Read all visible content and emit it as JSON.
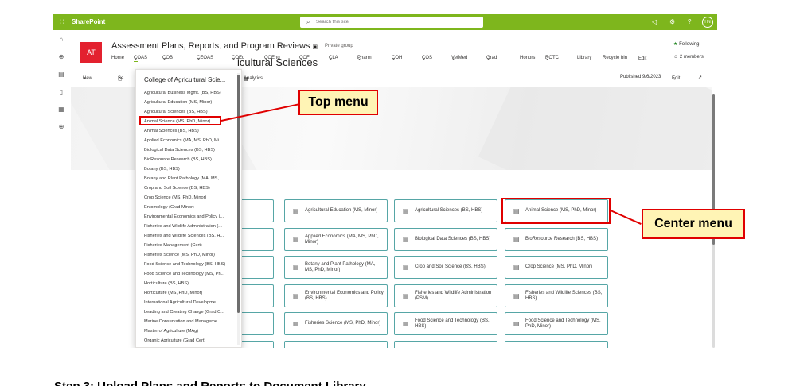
{
  "suitebar": {
    "app_name": "SharePoint",
    "search_placeholder": "Search this site",
    "avatar_initials": "HN"
  },
  "site": {
    "logo_text": "AT",
    "title": "Assessment Plans, Reports, and Program Reviews",
    "group_type": "Private group",
    "following": "Following",
    "members": "2 members",
    "nav": [
      "Home",
      "COAS",
      "COB",
      "CEOAS",
      "COEd",
      "COEng",
      "COF",
      "CLA",
      "Pharm",
      "COH",
      "COS",
      "VetMed",
      "Grad",
      "Honors",
      "ROTC",
      "Library",
      "Recycle bin",
      "Edit"
    ]
  },
  "commandbar": {
    "new": "New",
    "send": "Se",
    "analytics": "Analytics",
    "published": "Published 9/6/2023",
    "edit": "Edit"
  },
  "hero": {
    "title": "icultural Sciences"
  },
  "tiles": [
    "gmt. (BS,",
    "Agricultural Education (MS, Minor)",
    "Agricultural Sciences (BS, HBS)",
    "Animal Science (MS, PhD, Minor)",
    "S)",
    "Applied Economics (MA, MS, PhD, Minor)",
    "Biological Data Sciences (BS, HBS)",
    "BioResource Research (BS, HBS)",
    "",
    "Botany and Plant Pathology (MA, MS, PhD, Minor)",
    "Crop and Soil Science (BS, HBS)",
    "Crop Science (MS, PhD, Minor)",
    "or)",
    "Environmental Economics and Policy (BS, HBS)",
    "Fisheries and Wildlife Administration (PSM)",
    "Fisheries and Wildlife Sciences (BS, HBS)",
    "(Cert)",
    "Fisheries Science (MS, PhD, Minor)",
    "Food Science and Technology (BS, HBS)",
    "Food Science and Technology (MS, PhD, Minor)"
  ],
  "dropdown": {
    "header": "College of Agricultural Scie...",
    "items": [
      "Agricultural Business Mgmt. (BS, HBS)",
      "Agricultural Education (MS, Minor)",
      "Agricultural Sciences (BS, HBS)",
      "Animal Science (MS, PhD, Minor)",
      "Animal Sciences (BS, HBS)",
      "Applied Economics (MA, MS, PhD, Mi...",
      "Biological Data Sciences (BS, HBS)",
      "BioResource Research (BS, HBS)",
      "Botany (BS, HBS)",
      "Botany and Plant Pathology (MA, MS,...",
      "Crop and Soil Science (BS, HBS)",
      "Crop Science (MS, PhD, Minor)",
      "Entomology (Grad Minor)",
      "Environmental Economics and Policy (...",
      "Fisheries and Wildlife Administration (...",
      "Fisheries and Wildlife Sciences (BS, H...",
      "Fisheries Management (Cert)",
      "Fisheries Science (MS, PhD, Minor)",
      "Food Science and Technology (BS, HBS)",
      "Food Science and Technology (MS, Ph...",
      "Horticulture (BS, HBS)",
      "Horticulture (MS, PhD, Minor)",
      "International Agricultural Developme...",
      "Leading and Creating Change (Grad C...",
      "Marine Conservation and Manageme...",
      "Master of Agriculture (MAg)",
      "Organic Agriculture (Grad Cert)"
    ]
  },
  "annotations": {
    "top_menu": "Top menu",
    "center_menu": "Center menu"
  },
  "bottom_text": "Step 3: Upload Plans and Reports to Document Library"
}
